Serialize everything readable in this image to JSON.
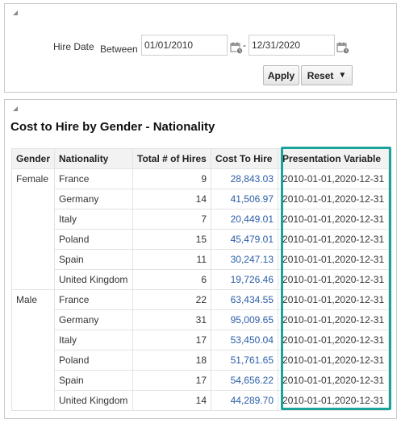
{
  "filter": {
    "hire_date_label": "Hire Date",
    "between_label": "Between",
    "from_value": "01/01/2010",
    "to_value": "12/31/2020",
    "separator": "-",
    "apply_label": "Apply",
    "reset_label": "Reset",
    "reset_caret": "▼"
  },
  "report": {
    "title": "Cost to Hire by Gender - Nationality",
    "columns": [
      "Gender",
      "Nationality",
      "Total # of Hires",
      "Cost To Hire",
      "Presentation Variable"
    ],
    "groups": [
      {
        "gender": "Female",
        "rows": [
          {
            "nationality": "France",
            "hires": "9",
            "cost": "28,843.03",
            "pv": "2010-01-01,2020-12-31"
          },
          {
            "nationality": "Germany",
            "hires": "14",
            "cost": "41,506.97",
            "pv": "2010-01-01,2020-12-31"
          },
          {
            "nationality": "Italy",
            "hires": "7",
            "cost": "20,449.01",
            "pv": "2010-01-01,2020-12-31"
          },
          {
            "nationality": "Poland",
            "hires": "15",
            "cost": "45,479.01",
            "pv": "2010-01-01,2020-12-31"
          },
          {
            "nationality": "Spain",
            "hires": "11",
            "cost": "30,247.13",
            "pv": "2010-01-01,2020-12-31"
          },
          {
            "nationality": "United Kingdom",
            "hires": "6",
            "cost": "19,726.46",
            "pv": "2010-01-01,2020-12-31"
          }
        ]
      },
      {
        "gender": "Male",
        "rows": [
          {
            "nationality": "France",
            "hires": "22",
            "cost": "63,434.55",
            "pv": "2010-01-01,2020-12-31"
          },
          {
            "nationality": "Germany",
            "hires": "31",
            "cost": "95,009.65",
            "pv": "2010-01-01,2020-12-31"
          },
          {
            "nationality": "Italy",
            "hires": "17",
            "cost": "53,450.04",
            "pv": "2010-01-01,2020-12-31"
          },
          {
            "nationality": "Poland",
            "hires": "18",
            "cost": "51,761.65",
            "pv": "2010-01-01,2020-12-31"
          },
          {
            "nationality": "Spain",
            "hires": "17",
            "cost": "54,656.22",
            "pv": "2010-01-01,2020-12-31"
          },
          {
            "nationality": "United Kingdom",
            "hires": "14",
            "cost": "44,289.70",
            "pv": "2010-01-01,2020-12-31"
          }
        ]
      }
    ]
  },
  "colors": {
    "highlight_border": "#1aa39a",
    "link_value": "#2b5ea7"
  },
  "icons": [
    "collapse-triangle-icon",
    "calendar-icon"
  ]
}
